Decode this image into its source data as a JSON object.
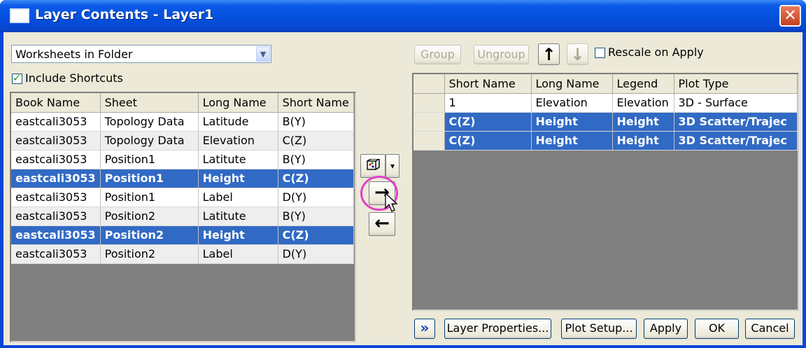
{
  "window": {
    "title": "Layer Contents - Layer1",
    "close_glyph": "✕"
  },
  "left": {
    "source_combo": {
      "value": "Worksheets in Folder"
    },
    "include_shortcuts": {
      "label": "Include Shortcuts",
      "checked": true
    },
    "columns": [
      "Book Name",
      "Sheet",
      "Long Name",
      "Short Name"
    ],
    "rows": [
      {
        "book": "eastcali3053",
        "sheet": "Topology Data",
        "long": "Latitude",
        "short": "B(Y)",
        "selected": false
      },
      {
        "book": "eastcali3053",
        "sheet": "Topology Data",
        "long": "Elevation",
        "short": "C(Z)",
        "selected": false
      },
      {
        "book": "eastcali3053",
        "sheet": "Position1",
        "long": "Latitute",
        "short": "B(Y)",
        "selected": false
      },
      {
        "book": "eastcali3053",
        "sheet": "Position1",
        "long": "Height",
        "short": "C(Z)",
        "selected": true
      },
      {
        "book": "eastcali3053",
        "sheet": "Position1",
        "long": "Label",
        "short": "D(Y)",
        "selected": false
      },
      {
        "book": "eastcali3053",
        "sheet": "Position2",
        "long": "Latitute",
        "short": "B(Y)",
        "selected": false
      },
      {
        "book": "eastcali3053",
        "sheet": "Position2",
        "long": "Height",
        "short": "C(Z)",
        "selected": true
      },
      {
        "book": "eastcali3053",
        "sheet": "Position2",
        "long": "Label",
        "short": "D(Y)",
        "selected": false
      }
    ]
  },
  "middle": {
    "plot_type_icon": "3d-plot-icon",
    "add_glyph": "→",
    "remove_glyph": "←",
    "dropdown_glyph": "▾"
  },
  "right": {
    "toolbar": {
      "group_label": "Group",
      "ungroup_label": "Ungroup",
      "up_glyph": "↑",
      "down_glyph": "↓",
      "rescale": {
        "label": "Rescale on Apply",
        "checked": false
      }
    },
    "columns": [
      "Short Name",
      "Long Name",
      "Legend",
      "Plot Type"
    ],
    "rows": [
      {
        "short": "1",
        "long": "Elevation",
        "legend": "Elevation",
        "plot": "3D - Surface",
        "selected": false
      },
      {
        "short": "C(Z)",
        "long": "Height",
        "legend": "Height",
        "plot": "3D Scatter/Trajec",
        "selected": true
      },
      {
        "short": "C(Z)",
        "long": "Height",
        "legend": "Height",
        "plot": "3D Scatter/Trajec",
        "selected": true
      }
    ]
  },
  "bottom": {
    "expand_glyph": "»",
    "layer_properties_label": "Layer Properties...",
    "plot_setup_label": "Plot Setup...",
    "apply_label": "Apply",
    "ok_label": "OK",
    "cancel_label": "Cancel"
  },
  "colors": {
    "title_blue": "#0a5ae8",
    "selection": "#316ac5",
    "highlight_ring": "#e040c8",
    "dialog_bg": "#ece9d8"
  }
}
